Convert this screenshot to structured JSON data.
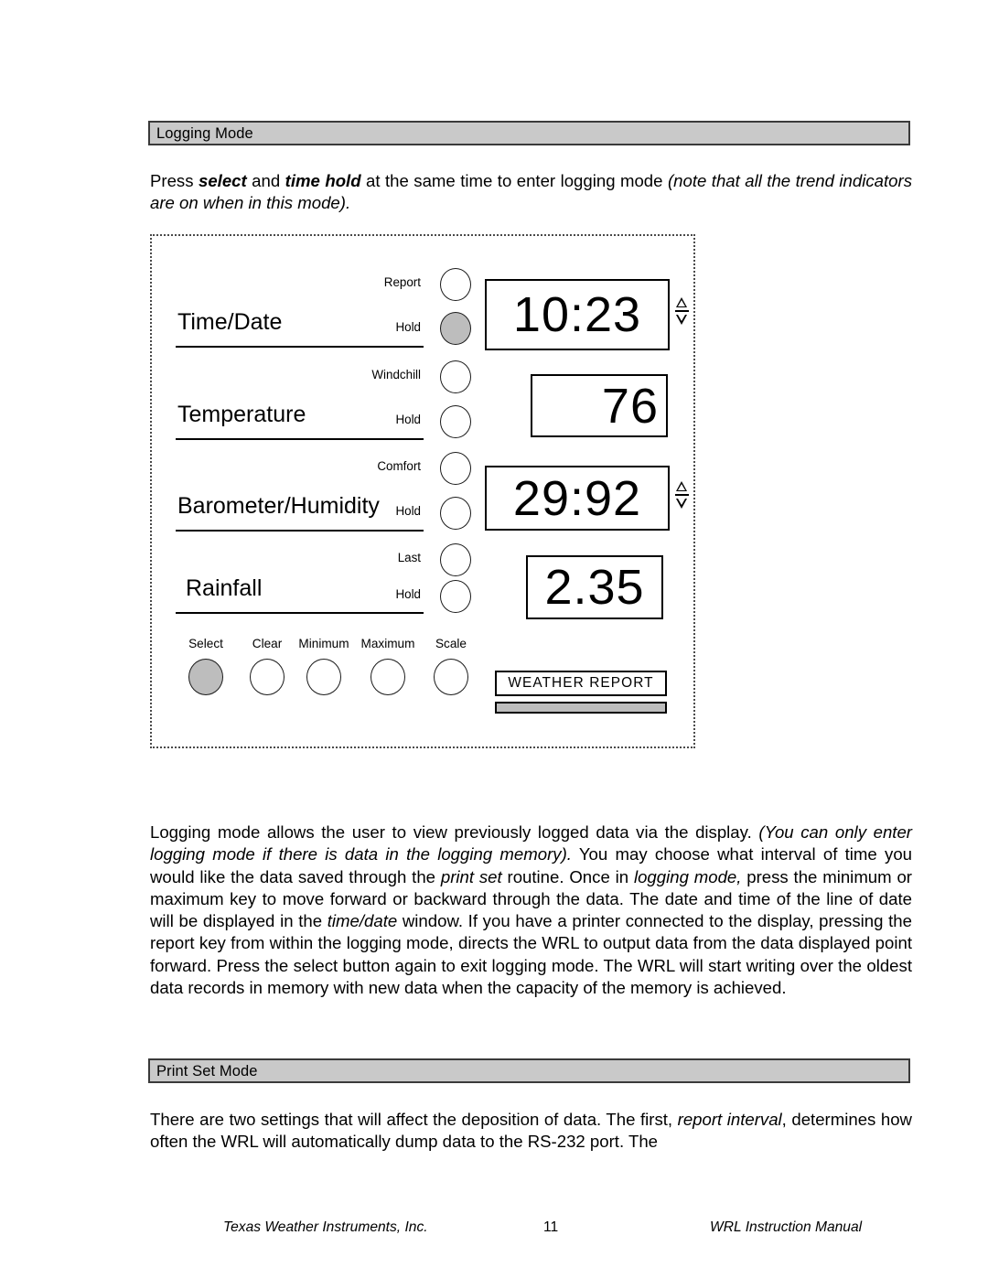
{
  "sections": {
    "logging": {
      "title": "Logging Mode"
    },
    "printset": {
      "title": "Print Set Mode"
    }
  },
  "paragraphs": {
    "intro_1": "Press ",
    "intro_select": "select",
    "intro_2": " and ",
    "intro_timehold": "time hold",
    "intro_3": " at the same time to enter logging mode ",
    "intro_note": "(note that all the trend indicators are on when in this mode).",
    "body_1": "Logging mode allows the user to view previously logged data via the display.  ",
    "body_i1": "(You can only enter logging mode if there is data in the logging memory).",
    "body_2": "  You may choose what interval of time you would like the data saved through the ",
    "body_i2": "print set",
    "body_3": " routine.  Once in ",
    "body_i3": "logging mode,",
    "body_4": " press the minimum or maximum key to move forward or backward through the data.  The date and time of the line of date will be displayed in the ",
    "body_i4": "time/date",
    "body_5": " window.  If you have a printer connected to the display, pressing the report key from within the logging mode, directs the WRL to output data from the data displayed point forward.  Press the select button again to exit logging mode.  The WRL will start writing over the oldest data records in memory with new data when the capacity of the memory is achieved.",
    "print_1": "There are two settings that will affect the deposition of data.  The first, ",
    "print_i1": "report interval",
    "print_2": ", determines how often the WRL will automatically dump data to the RS-232 port.  The"
  },
  "device": {
    "channels": [
      {
        "name": "Time/Date",
        "upper_key": "Report",
        "hold_key": "Hold",
        "hold_pressed": true,
        "display": "10:23",
        "has_trend": true,
        "align": "center"
      },
      {
        "name": "Temperature",
        "upper_key": "Windchill",
        "hold_key": "Hold",
        "hold_pressed": false,
        "display": "76",
        "has_trend": false,
        "align": "right"
      },
      {
        "name": "Barometer/Humidity",
        "upper_key": "Comfort",
        "hold_key": "Hold",
        "hold_pressed": false,
        "display": "29:92",
        "has_trend": true,
        "align": "center"
      },
      {
        "name": "Rainfall",
        "upper_key": "Last",
        "hold_key": "Hold",
        "hold_pressed": false,
        "display": "2.35",
        "has_trend": false,
        "align": "center"
      }
    ],
    "bottom_buttons": [
      {
        "label": "Select",
        "pressed": true
      },
      {
        "label": "Clear",
        "pressed": false
      },
      {
        "label": "Minimum",
        "pressed": false
      },
      {
        "label": "Maximum",
        "pressed": false
      },
      {
        "label": "Scale",
        "pressed": false
      }
    ],
    "weather_report_label": "WEATHER REPORT"
  },
  "footer": {
    "left": "Texas Weather Instruments, Inc.",
    "page_number": "11",
    "right": "WRL Instruction Manual"
  },
  "colors": {
    "bar_fill": "#c9c9c9",
    "bar_border": "#3a3a3a",
    "button_pressed": "#bdbdbd",
    "ink": "#000000",
    "paper": "#ffffff"
  }
}
